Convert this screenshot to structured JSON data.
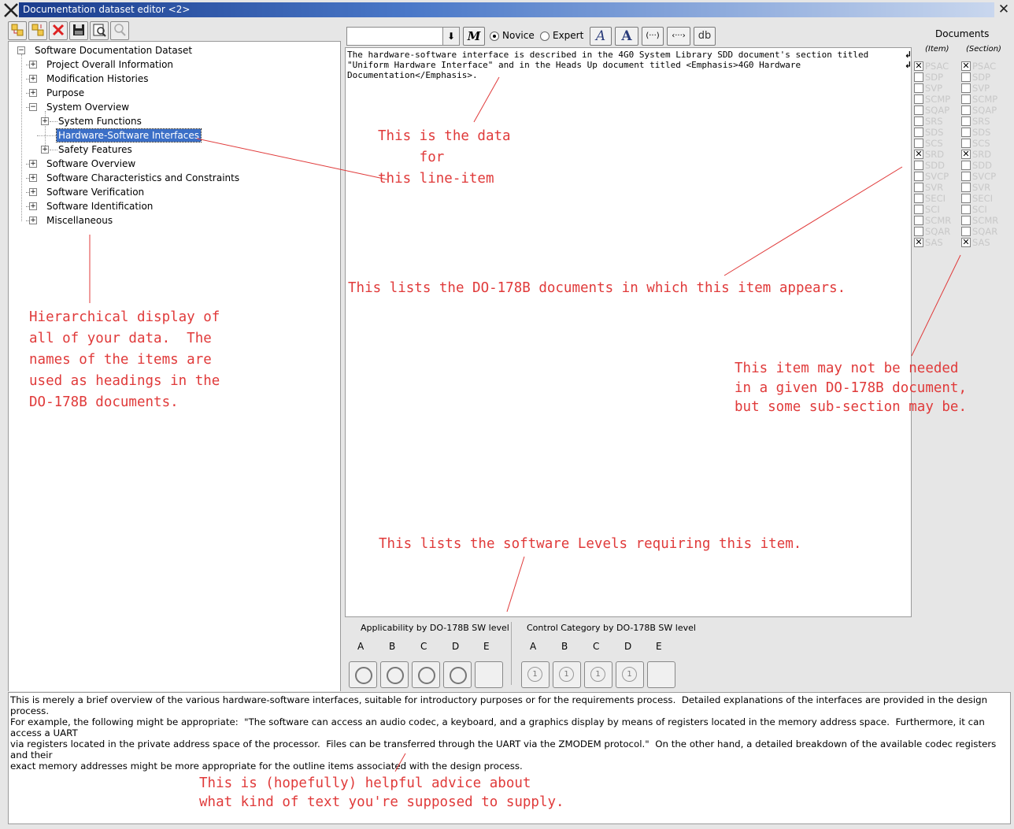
{
  "window": {
    "title": "Documentation dataset editor <2>"
  },
  "tree": {
    "root": "Software Documentation Dataset",
    "items": [
      "Project Overall Information",
      "Modification Histories",
      "Purpose",
      "System Overview",
      "System Functions",
      "Hardware-Software Interfaces",
      "Safety Features",
      "Software Overview",
      "Software Characteristics and Constraints",
      "Software Verification",
      "Software Identification",
      "Miscellaneous"
    ]
  },
  "editor_toolbar": {
    "mode_novice": "Novice",
    "mode_expert": "Expert",
    "btn_m": "M",
    "btn_a_italic": "A",
    "btn_a_bold": "A",
    "btn_paren": "(···)",
    "btn_angle": "‹···›",
    "btn_db": "db"
  },
  "editor": {
    "text": "The hardware-software interface is described in the 4G0 System Library SDD document's section titled\n\"Uniform Hardware Interface\" and in the Heads Up document titled <Emphasis>4G0 Hardware\nDocumentation</Emphasis>."
  },
  "documents": {
    "title": "Documents",
    "col_item": "(Item)",
    "col_section": "(Section)",
    "names": [
      "PSAC",
      "SDP",
      "SVP",
      "SCMP",
      "SQAP",
      "SRS",
      "SDS",
      "SCS",
      "SRD",
      "SDD",
      "SVCP",
      "SVR",
      "SECI",
      "SCI",
      "SCMR",
      "SQAR",
      "SAS"
    ],
    "item_checked": [
      true,
      false,
      false,
      false,
      false,
      false,
      false,
      false,
      true,
      false,
      false,
      false,
      false,
      false,
      false,
      false,
      true
    ],
    "section_checked": [
      true,
      false,
      false,
      false,
      false,
      false,
      false,
      false,
      true,
      false,
      false,
      false,
      false,
      false,
      false,
      false,
      true
    ]
  },
  "levels": {
    "applicability_title": "Applicability by DO-178B SW level",
    "control_title": "Control Category by DO-178B SW level",
    "letters": [
      "A",
      "B",
      "C",
      "D",
      "E"
    ],
    "control_value": "1"
  },
  "advice": {
    "p1": "This is merely a brief overview of the various hardware-software interfaces, suitable for introductory purposes or for the requirements process.  Detailed explanations of the interfaces are provided in the design process.",
    "p2": "For example, the following might be appropriate:  \"The software can access an audio codec, a keyboard, and a graphics display by means of registers located in the memory address space.  Furthermore, it can access a UART\nvia registers located in the private address space of the processor.  Files can be transferred through the UART via the ZMODEM protocol.\"  On the other hand, a detailed breakdown of the available codec registers and their\nexact memory addresses might be more appropriate for the outline items associated with the design process."
  },
  "annotations": {
    "data_note": "This is the data\n     for\nthis line-item",
    "docs_note": "This lists the DO-178B documents in which this item appears.",
    "tree_note": "Hierarchical display of\nall of your data.  The\nnames of the items are\nused as headings in the\nDO-178B documents.",
    "section_note": "This item may not be needed\nin a given DO-178B document,\nbut some sub-section may be.",
    "levels_note": "This lists the software Levels requiring this item.",
    "advice_note": "This is (hopefully) helpful advice about\nwhat kind of text you're supposed to supply."
  },
  "colors": {
    "annotation": "#e03a3a",
    "selection": "#3b6fc7",
    "title_gradient_start": "#1a3c8c"
  }
}
